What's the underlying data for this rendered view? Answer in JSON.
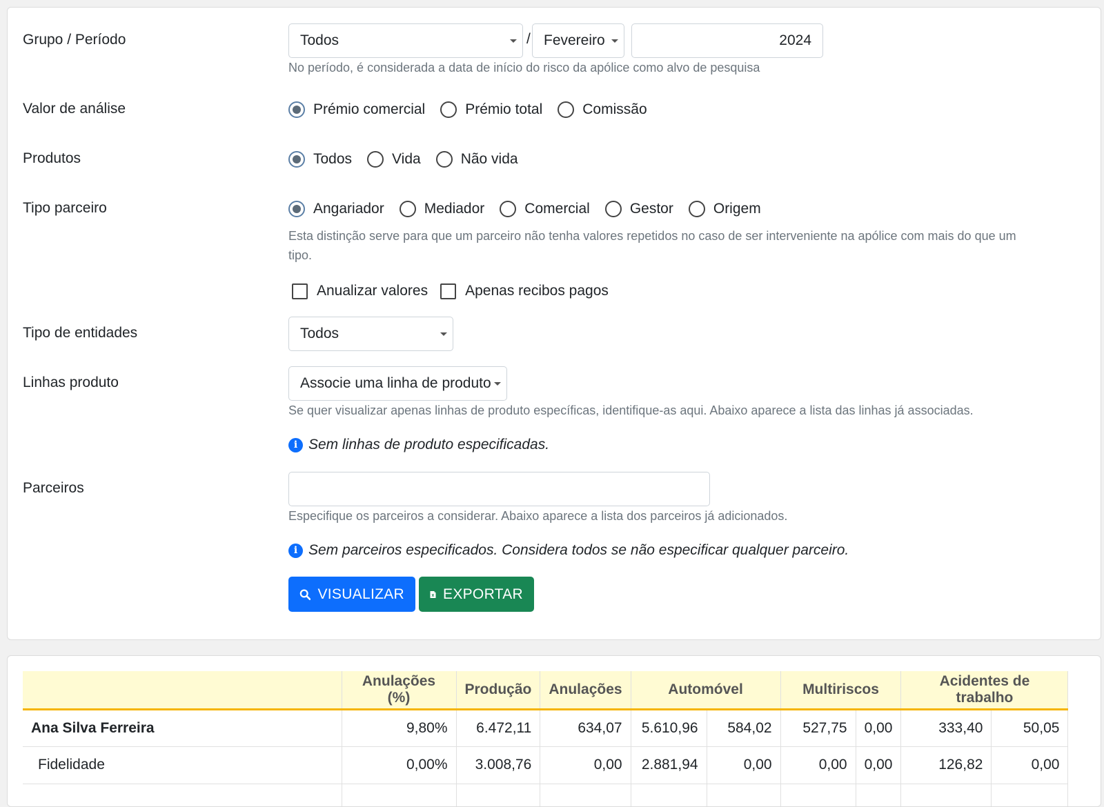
{
  "form": {
    "grupo_periodo": {
      "label": "Grupo / Período",
      "grupo": "Todos",
      "separator": "/",
      "mes": "Fevereiro",
      "ano": "2024",
      "help": "No período, é considerada a data de início do risco da apólice como alvo de pesquisa"
    },
    "valor_analise": {
      "label": "Valor de análise",
      "options": [
        "Prémio comercial",
        "Prémio total",
        "Comissão"
      ],
      "selected": "Prémio comercial"
    },
    "produtos": {
      "label": "Produtos",
      "options": [
        "Todos",
        "Vida",
        "Não vida"
      ],
      "selected": "Todos"
    },
    "tipo_parceiro": {
      "label": "Tipo parceiro",
      "options": [
        "Angariador",
        "Mediador",
        "Comercial",
        "Gestor",
        "Origem"
      ],
      "selected": "Angariador",
      "help_line1": "Esta distinção serve para que um parceiro não tenha valores repetidos no caso de ser interveniente na apólice com mais do que um",
      "help_line2": "tipo."
    },
    "checkboxes": {
      "anualizar": "Anualizar valores",
      "apenas_pagos": "Apenas recibos pagos"
    },
    "tipo_entidades": {
      "label": "Tipo de entidades",
      "value": "Todos"
    },
    "linhas_produto": {
      "label": "Linhas produto",
      "value": "Associe uma linha de produto",
      "help": "Se quer visualizar apenas linhas de produto específicas, identifique-as aqui. Abaixo aparece a lista das linhas já associadas.",
      "info": "Sem linhas de produto especificadas."
    },
    "parceiros": {
      "label": "Parceiros",
      "value": "",
      "help": "Especifique os parceiros a considerar. Abaixo aparece a lista dos parceiros já adicionados.",
      "info": "Sem parceiros especificados. Considera todos se não especificar qualquer parceiro."
    },
    "buttons": {
      "visualizar": "VISUALIZAR",
      "exportar": "EXPORTAR"
    }
  },
  "table": {
    "headers": [
      "",
      "Anulações (%)",
      "Produção",
      "Anulações",
      "Automóvel",
      "Multiriscos",
      "Acidentes de trabalho"
    ],
    "rows": [
      {
        "name": "Ana Silva Ferreira",
        "cells": [
          "9,80%",
          "6.472,11",
          "634,07",
          "5.610,96",
          "584,02",
          "527,75",
          "0,00",
          "333,40",
          "50,05"
        ]
      },
      {
        "name": "Fidelidade",
        "cells": [
          "0,00%",
          "3.008,76",
          "0,00",
          "2.881,94",
          "0,00",
          "0,00",
          "0,00",
          "126,82",
          "0,00"
        ]
      }
    ]
  },
  "colors": {
    "primary": "#0d6efd",
    "success": "#198754",
    "table_header_bg": "#fffbd3",
    "table_header_border": "#f5b400"
  }
}
